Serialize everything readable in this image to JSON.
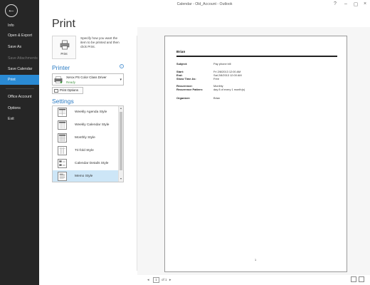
{
  "window": {
    "title": "Calendar - Old_Account - Outlook",
    "controls": [
      "?",
      "–",
      "▢",
      "×"
    ]
  },
  "sidebar": {
    "items": [
      {
        "label": "Info",
        "state": "normal"
      },
      {
        "label": "Open & Export",
        "state": "normal"
      },
      {
        "label": "Save As",
        "state": "normal"
      },
      {
        "label": "Save Attachments",
        "state": "disabled"
      },
      {
        "label": "Save Calendar",
        "state": "normal"
      },
      {
        "label": "Print",
        "state": "active"
      },
      {
        "label": "Office Account",
        "state": "normal"
      },
      {
        "label": "Options",
        "state": "normal"
      },
      {
        "label": "Exit",
        "state": "normal"
      }
    ]
  },
  "page_title": "Print",
  "print_button": {
    "label": "Print",
    "description": "Specify how you want the item to be printed and then click Print."
  },
  "printer": {
    "heading": "Printer",
    "name": "Xerox PS Color Class Driver",
    "status": "Ready",
    "options_label": "Print Options"
  },
  "settings": {
    "heading": "Settings",
    "styles": [
      {
        "label": "Weekly Agenda Style",
        "selected": false
      },
      {
        "label": "Weekly Calendar Style",
        "selected": false
      },
      {
        "label": "Monthly Style",
        "selected": false
      },
      {
        "label": "Tri-fold Style",
        "selected": false
      },
      {
        "label": "Calendar Details Style",
        "selected": false
      },
      {
        "label": "Memo Style",
        "selected": true
      }
    ]
  },
  "preview": {
    "header_name": "Brian",
    "rows": [
      {
        "label": "Subject:",
        "value": "Pay phone bill"
      },
      {
        "label": "Start:",
        "value": "Fri 2/8/2013 12:00 AM"
      },
      {
        "label": "End:",
        "value": "Sat 2/8/2013 12:00 AM"
      },
      {
        "label": "Show Time As:",
        "value": "Free"
      },
      {
        "label": "Recurrence:",
        "value": "Monthly"
      },
      {
        "label": "Recurrence Pattern:",
        "value": "day 8 of every 1 month(s)"
      },
      {
        "label": "Organizer:",
        "value": "Brian"
      }
    ],
    "page_number": "1"
  },
  "pager": {
    "current": "1",
    "of_text": "of 1",
    "prev": "◂",
    "next": "▸"
  },
  "colors": {
    "sidebar": "#262626",
    "accent": "#2a8ad4",
    "heading": "#2a7bc4",
    "selected": "#cde6f7"
  }
}
